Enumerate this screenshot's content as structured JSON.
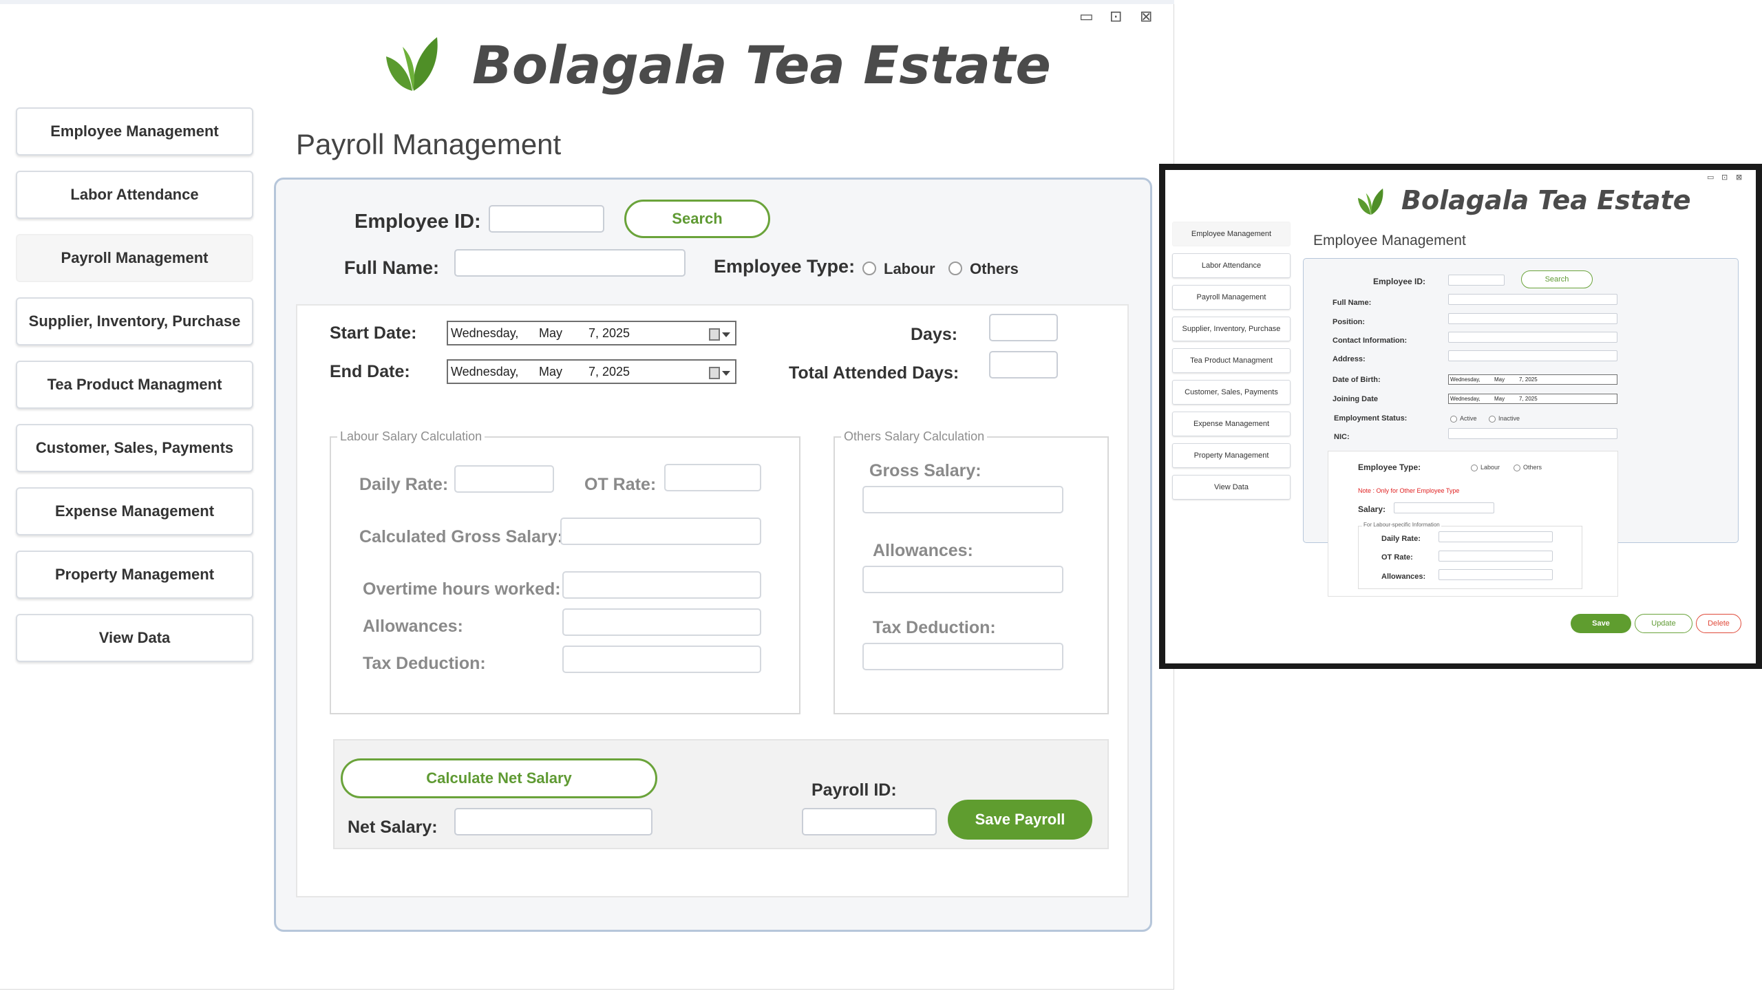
{
  "brand": {
    "title": "Bolagala Tea Estate",
    "leaf_color": "#5a9a2e"
  },
  "colors": {
    "accent": "#5f9d2f",
    "danger": "#e04a3a",
    "note": "#e02020"
  },
  "window_controls": {
    "minimize": "▭",
    "restore": "⊡",
    "close": "⊠"
  },
  "sidebar": {
    "items": [
      {
        "label": "Employee Management"
      },
      {
        "label": "Labor Attendance"
      },
      {
        "label": "Payroll Management"
      },
      {
        "label": "Supplier, Inventory, Purchase"
      },
      {
        "label": "Tea Product Managment"
      },
      {
        "label": "Customer, Sales, Payments"
      },
      {
        "label": "Expense Management"
      },
      {
        "label": "Property Management"
      },
      {
        "label": "View Data"
      }
    ],
    "active_index": 2
  },
  "payroll": {
    "title": "Payroll Management",
    "employee_id_label": "Employee ID:",
    "search_label": "Search",
    "full_name_label": "Full Name:",
    "employee_type_label": "Employee Type:",
    "type_labour": "Labour",
    "type_others": "Others",
    "start_date_label": "Start Date:",
    "end_date_label": "End Date:",
    "start_date": {
      "day": "Wednesday,",
      "month": "May",
      "date": "7, 2025"
    },
    "end_date": {
      "day": "Wednesday,",
      "month": "May",
      "date": "7, 2025"
    },
    "days_label": "Days:",
    "total_attended_label": "Total Attended Days:",
    "labour_group": {
      "title": "Labour Salary Calculation",
      "daily_rate": "Daily Rate:",
      "ot_rate": "OT Rate:",
      "calc_gross": "Calculated Gross Salary:",
      "ot_hours": "Overtime hours worked:",
      "allowances": "Allowances:",
      "tax": "Tax Deduction:"
    },
    "others_group": {
      "title": "Others Salary Calculation",
      "gross": "Gross Salary:",
      "allowances": "Allowances:",
      "tax": "Tax Deduction:"
    },
    "calc_net_label": "Calculate Net Salary",
    "net_salary_label": "Net Salary:",
    "payroll_id_label": "Payroll ID:",
    "save_label": "Save Payroll"
  },
  "employee_window": {
    "brand": "Bolagala Tea Estate",
    "title": "Employee Management",
    "sidebar": [
      "Employee Management",
      "Labor Attendance",
      "Payroll Management",
      "Supplier, Inventory, Purchase",
      "Tea Product Managment",
      "Customer, Sales, Payments",
      "Expense Management",
      "Property Management",
      "View Data"
    ],
    "employee_id": "Employee ID:",
    "search": "Search",
    "full_name": "Full Name:",
    "position": "Position:",
    "contact": "Contact Information:",
    "address": "Address:",
    "dob": "Date of Birth:",
    "joining": "Joining Date",
    "dob_value": {
      "day": "Wednesday,",
      "month": "May",
      "date": "7, 2025"
    },
    "joining_value": {
      "day": "Wednesday,",
      "month": "May",
      "date": "7, 2025"
    },
    "status": "Employment Status:",
    "active": "Active",
    "inactive": "Inactive",
    "nic": "NIC:",
    "employee_type": "Employee Type:",
    "labour": "Labour",
    "others": "Others",
    "note": "Note : Only for Other Employee Type",
    "salary": "Salary:",
    "labour_info": "For Labour-specific Information",
    "daily_rate": "Daily Rate:",
    "ot_rate": "OT Rate:",
    "allowances": "Allowances:",
    "save": "Save",
    "update": "Update",
    "delete": "Delete"
  }
}
